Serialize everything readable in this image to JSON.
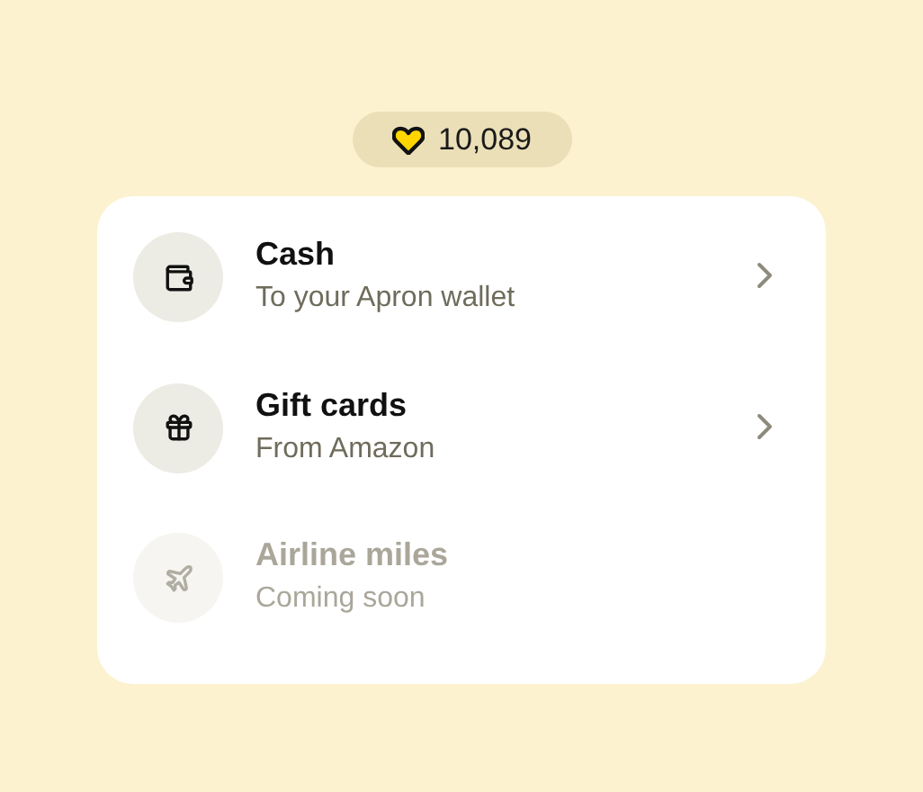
{
  "balance": {
    "amount": "10,089"
  },
  "options": [
    {
      "kind": "wallet",
      "title": "Cash",
      "subtitle": "To your Apron wallet",
      "disabled": false
    },
    {
      "kind": "gift",
      "title": "Gift cards",
      "subtitle": "From Amazon",
      "disabled": false
    },
    {
      "kind": "plane",
      "title": "Airline miles",
      "subtitle": "Coming soon",
      "disabled": true
    }
  ]
}
